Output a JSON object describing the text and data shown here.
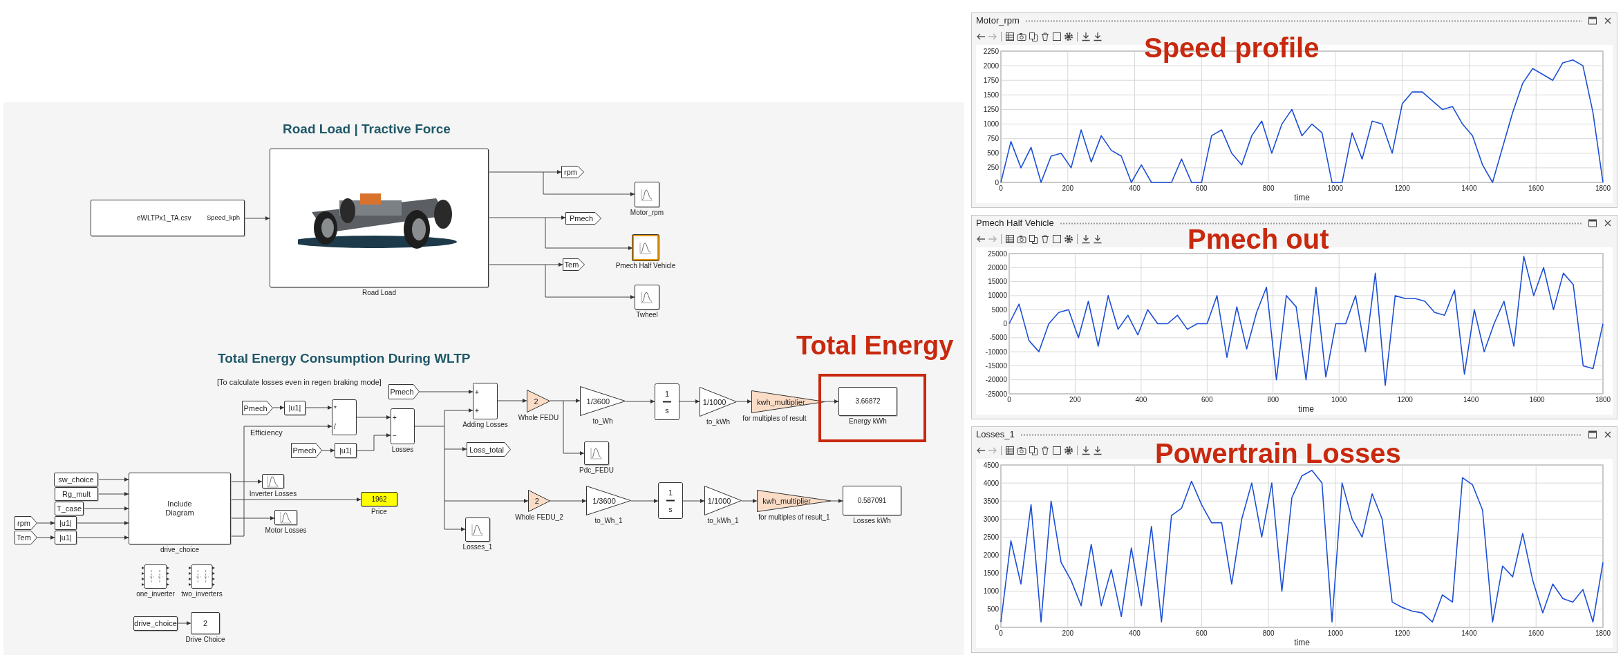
{
  "diagram": {
    "titles": [
      "Road Load | Tractive Force",
      "Total Energy Consumption During WLTP"
    ],
    "notes": [
      "[To calculate losses even in regen braking mode]",
      "Efficiency"
    ],
    "callout": "Total Energy",
    "blocks": [
      {
        "kind": "from_file",
        "text": "eWLTPx1_TA.csv",
        "port": "Speed_kph"
      },
      {
        "kind": "picture_subsystem",
        "label": "Road Load"
      },
      {
        "kind": "goto",
        "text": "rpm"
      },
      {
        "kind": "scope",
        "label": "Motor_rpm",
        "selected": false
      },
      {
        "kind": "goto",
        "text": "Pmech"
      },
      {
        "kind": "goto",
        "text": "Tem"
      },
      {
        "kind": "scope",
        "label": "Pmech Half Vehicle",
        "selected": true
      },
      {
        "kind": "scope",
        "label": "Twheel",
        "selected": false
      },
      {
        "kind": "from",
        "text": "Pmech"
      },
      {
        "kind": "abs",
        "text": "|u1|"
      },
      {
        "kind": "product",
        "ports": [
          "*",
          "/"
        ]
      },
      {
        "kind": "from",
        "text": "Pmech"
      },
      {
        "kind": "abs",
        "text": "|u1|"
      },
      {
        "kind": "from",
        "text": "Pmech"
      },
      {
        "kind": "sum",
        "ports": [
          "+",
          "−"
        ],
        "label": "Losses"
      },
      {
        "kind": "sum",
        "ports": [
          "+",
          "+"
        ],
        "label": "Adding Losses"
      },
      {
        "kind": "gain",
        "text": "2",
        "label": "Whole FEDU",
        "color": "#fbdcc6"
      },
      {
        "kind": "gain",
        "text": "1/3600",
        "label": "to_Wh",
        "color": "#ffffff"
      },
      {
        "kind": "integrator",
        "numerator": "1",
        "denominator": "s"
      },
      {
        "kind": "gain",
        "text": "1/1000",
        "label": "to_kWh",
        "color": "#ffffff"
      },
      {
        "kind": "gain",
        "text": "kwh_multiplier",
        "label": "for multiples of result",
        "color": "#fbdcc6"
      },
      {
        "kind": "display",
        "text": "3.66872",
        "label": "Energy kWh",
        "highlighted": false
      },
      {
        "kind": "goto",
        "text": "Loss_total"
      },
      {
        "kind": "scope",
        "label": "Pdc_FEDU",
        "selected": false
      },
      {
        "kind": "constant",
        "text": "sw_choice"
      },
      {
        "kind": "constant",
        "text": "Rg_mult"
      },
      {
        "kind": "constant",
        "text": "T_case"
      },
      {
        "kind": "from",
        "text": "rpm"
      },
      {
        "kind": "from",
        "text": "Tem"
      },
      {
        "kind": "abs",
        "text": "|u1|"
      },
      {
        "kind": "abs",
        "text": "|u1|"
      },
      {
        "kind": "subsystem",
        "text": "Include Diagram",
        "label": "drive_choice"
      },
      {
        "kind": "scope",
        "label": "Inverter Losses",
        "selected": false
      },
      {
        "kind": "display",
        "text": "1962",
        "label": "Price",
        "highlighted": true
      },
      {
        "kind": "scope",
        "label": "Motor Losses",
        "selected": false
      },
      {
        "kind": "gain",
        "text": "2",
        "label": "Whole FEDU_2",
        "color": "#fbdcc6"
      },
      {
        "kind": "gain",
        "text": "1/3600",
        "label": "to_Wh_1",
        "color": "#ffffff"
      },
      {
        "kind": "integrator",
        "numerator": "1",
        "denominator": "s"
      },
      {
        "kind": "gain",
        "text": "1/1000",
        "label": "to_kWh_1",
        "color": "#ffffff"
      },
      {
        "kind": "gain",
        "text": "kwh_multiplier",
        "label": "for multiples of result_1",
        "color": "#fbdcc6"
      },
      {
        "kind": "display",
        "text": "0.587091",
        "label": "Losses kWh",
        "highlighted": false
      },
      {
        "kind": "scope",
        "label": "Losses_1",
        "selected": false
      },
      {
        "kind": "variant",
        "label": "one_inverter"
      },
      {
        "kind": "variant",
        "label": "two_inverters"
      },
      {
        "kind": "constant",
        "text": "drive_choice"
      },
      {
        "kind": "constant",
        "text": "2",
        "label": "Drive Choice"
      }
    ]
  },
  "scopes": [
    {
      "title": "Motor_rpm",
      "callout": "Speed profile",
      "nav_buttons": [
        {
          "disabled": false
        },
        {
          "disabled": true
        }
      ],
      "chart_data": {
        "type": "line",
        "grid": true,
        "xlabel": "time",
        "xlim": [
          0,
          1800
        ],
        "ylim": [
          0,
          2250
        ],
        "xticks": [
          0,
          200,
          400,
          600,
          800,
          1000,
          1200,
          1400,
          1600,
          1800
        ],
        "yticks": [
          0,
          250,
          500,
          750,
          1000,
          1250,
          1500,
          1750,
          2000,
          2250
        ],
        "x": [
          0,
          30,
          60,
          90,
          120,
          150,
          180,
          210,
          240,
          270,
          300,
          330,
          360,
          390,
          420,
          450,
          480,
          510,
          540,
          570,
          600,
          630,
          660,
          690,
          720,
          750,
          780,
          810,
          840,
          870,
          900,
          930,
          960,
          990,
          1020,
          1050,
          1080,
          1110,
          1140,
          1170,
          1200,
          1230,
          1260,
          1290,
          1320,
          1350,
          1380,
          1410,
          1440,
          1470,
          1500,
          1530,
          1560,
          1590,
          1620,
          1650,
          1680,
          1710,
          1740,
          1770,
          1800
        ],
        "values": [
          0,
          700,
          250,
          600,
          0,
          450,
          500,
          250,
          900,
          350,
          800,
          550,
          450,
          0,
          300,
          0,
          0,
          0,
          400,
          0,
          0,
          800,
          900,
          500,
          300,
          800,
          1050,
          500,
          1000,
          1250,
          800,
          1000,
          850,
          0,
          0,
          850,
          400,
          1050,
          1000,
          500,
          1350,
          1550,
          1550,
          1400,
          1250,
          1300,
          1000,
          800,
          300,
          0,
          600,
          1200,
          1700,
          1950,
          1850,
          1750,
          2050,
          2100,
          2000,
          1200,
          0
        ]
      }
    },
    {
      "title": "Pmech Half Vehicle",
      "callout": "Pmech out",
      "nav_buttons": [
        {
          "disabled": false
        },
        {
          "disabled": true
        }
      ],
      "chart_data": {
        "type": "line",
        "grid": true,
        "xlabel": "time",
        "xlim": [
          0,
          1800
        ],
        "ylim": [
          -25000,
          25000
        ],
        "xticks": [
          0,
          200,
          400,
          600,
          800,
          1000,
          1200,
          1400,
          1600,
          1800
        ],
        "yticks": [
          -25000,
          -20000,
          -15000,
          -10000,
          -5000,
          0,
          5000,
          10000,
          15000,
          20000,
          25000
        ],
        "x": [
          0,
          30,
          60,
          90,
          120,
          150,
          180,
          210,
          240,
          270,
          300,
          330,
          360,
          390,
          420,
          450,
          480,
          510,
          540,
          570,
          600,
          630,
          660,
          690,
          720,
          750,
          780,
          810,
          840,
          870,
          900,
          930,
          960,
          990,
          1020,
          1050,
          1080,
          1110,
          1140,
          1170,
          1200,
          1230,
          1260,
          1290,
          1320,
          1350,
          1380,
          1410,
          1440,
          1470,
          1500,
          1530,
          1560,
          1590,
          1620,
          1650,
          1680,
          1710,
          1740,
          1770,
          1800
        ],
        "values": [
          0,
          7000,
          -6000,
          -10000,
          0,
          4000,
          5000,
          -5000,
          8000,
          -8000,
          10000,
          -2000,
          3000,
          -4000,
          5000,
          0,
          0,
          3000,
          -2000,
          0,
          0,
          10000,
          -12000,
          6000,
          -9000,
          4000,
          13000,
          -20000,
          10000,
          6000,
          -20000,
          13000,
          -19000,
          0,
          0,
          10000,
          -10000,
          18000,
          -22000,
          10000,
          9000,
          9000,
          8000,
          4000,
          3000,
          12000,
          -18000,
          5000,
          -10000,
          0,
          8000,
          -8000,
          24000,
          10000,
          20000,
          5000,
          18000,
          14000,
          -15000,
          -16000,
          0
        ]
      }
    },
    {
      "title": "Losses_1",
      "callout": "Powertrain Losses",
      "nav_buttons": [
        {
          "disabled": false
        },
        {
          "disabled": true
        }
      ],
      "chart_data": {
        "type": "line",
        "grid": true,
        "xlabel": "time",
        "xlim": [
          0,
          1800
        ],
        "ylim": [
          0,
          4500
        ],
        "xticks": [
          0,
          200,
          400,
          600,
          800,
          1000,
          1200,
          1400,
          1600,
          1800
        ],
        "yticks": [
          0,
          500,
          1000,
          1500,
          2000,
          2500,
          3000,
          3500,
          4000,
          4500
        ],
        "x": [
          0,
          30,
          60,
          90,
          120,
          150,
          180,
          210,
          240,
          270,
          300,
          330,
          360,
          390,
          420,
          450,
          480,
          510,
          540,
          570,
          600,
          630,
          660,
          690,
          720,
          750,
          780,
          810,
          840,
          870,
          900,
          930,
          960,
          990,
          1020,
          1050,
          1080,
          1110,
          1140,
          1170,
          1200,
          1230,
          1260,
          1290,
          1320,
          1350,
          1380,
          1410,
          1440,
          1470,
          1500,
          1530,
          1560,
          1590,
          1620,
          1650,
          1680,
          1710,
          1740,
          1770,
          1800
        ],
        "values": [
          150,
          2400,
          1200,
          3400,
          150,
          3500,
          1800,
          1300,
          600,
          2300,
          600,
          1600,
          300,
          2200,
          600,
          2800,
          150,
          3100,
          3300,
          4050,
          3400,
          2900,
          2900,
          1200,
          3000,
          4000,
          2500,
          4000,
          1000,
          3600,
          4200,
          4350,
          4000,
          150,
          4000,
          3000,
          2500,
          3700,
          3000,
          700,
          550,
          450,
          400,
          150,
          900,
          700,
          4150,
          3950,
          3250,
          150,
          1700,
          1400,
          2600,
          1300,
          400,
          1200,
          800,
          700,
          1050,
          150,
          1800
        ]
      }
    }
  ]
}
